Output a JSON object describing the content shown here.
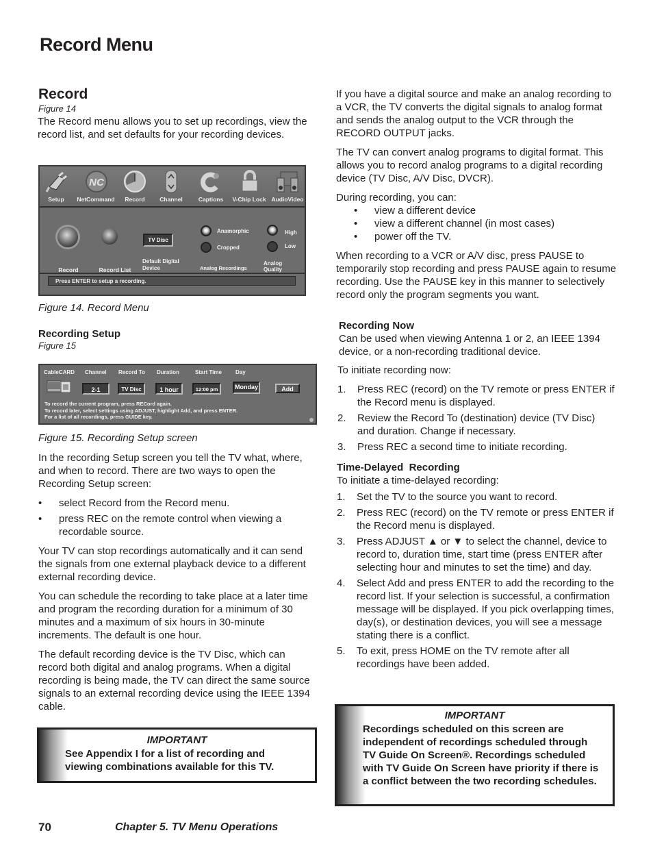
{
  "page": {
    "title": "Record Menu",
    "page_number": "70",
    "chapter": "Chapter 5. TV Menu Operations"
  },
  "left": {
    "record": {
      "heading": "Record",
      "figure_ref": "Figure 14",
      "intro": "The Record menu allows you to set up recordings, view the record list, and set defaults for your recording devices."
    },
    "figure14": {
      "caption": "Figure 14. Record Menu",
      "menu_items": [
        {
          "label": "Setup",
          "icon": "plug-icon"
        },
        {
          "label": "NetCommand",
          "icon": "netcommand-icon"
        },
        {
          "label": "Record",
          "icon": "clock-icon"
        },
        {
          "label": "Channel",
          "icon": "up-down-arrows-icon"
        },
        {
          "label": "Captions",
          "icon": "captions-icon"
        },
        {
          "label": "V-Chip Lock",
          "icon": "padlock-icon"
        },
        {
          "label": "AudioVideo",
          "icon": "speakers-icon"
        }
      ],
      "record_label": "Record",
      "record_list_label": "Record List",
      "default_device_value": "TV Disc",
      "default_device_label": "Default Digital Device",
      "analog_recordings": {
        "label": "Analog Recordings",
        "options": [
          {
            "label": "Anamorphic",
            "selected": true
          },
          {
            "label": "Cropped",
            "selected": false
          }
        ]
      },
      "analog_quality": {
        "label": "Analog Quality",
        "options": [
          {
            "label": "High",
            "selected": true
          },
          {
            "label": "Low",
            "selected": false
          }
        ]
      },
      "status": "Press ENTER to setup a recording."
    },
    "recording_setup": {
      "heading": "Recording Setup",
      "figure_ref": "Figure 15"
    },
    "figure15": {
      "caption": "Figure 15. Recording Setup screen",
      "columns": {
        "cablecard": "CableCARD",
        "channel": "Channel",
        "record_to": "Record To",
        "duration": "Duration",
        "start_time": "Start Time",
        "day": "Day"
      },
      "values": {
        "channel": "2-1",
        "record_to": "TV Disc",
        "duration": "1 hour",
        "start_time": "12:00 pm",
        "day": "Monday"
      },
      "add_button": "Add",
      "instructions": [
        "To record the current program, press RECord again.",
        "To record later, select settings using ADJUST, highlight Add, and press ENTER.",
        "For a list of all recordings, press GUIDE key."
      ]
    },
    "setup_intro": "In the recording Setup screen you tell the TV what, where, and when to record.  There are two ways to open the Recording Setup screen:",
    "setup_bullets": [
      "select Record from the Record menu.",
      "press REC on the remote control when viewing a recordable source."
    ],
    "paragraphs": [
      "Your TV can stop recordings automatically and it can send the signals from one external playback device to a different external recording device.",
      "You can schedule the recording to take place at a later time and program the recording duration for a minimum of 30 minutes and a maximum of six hours in 30-minute increments.  The default is one hour.",
      "The default recording device is the TV Disc, which can record both digital and analog programs.  When a digital recording is being made, the TV can direct the same source signals to an external recording device using the IEEE 1394 cable."
    ],
    "important": {
      "title": "IMPORTANT",
      "body": "See Appendix I for a list of recording and viewing combinations available for this TV."
    }
  },
  "right": {
    "paragraphs": [
      "If you have a digital source and make an analog recording to a VCR, the TV converts the digital signals to analog format and sends the analog output to the VCR through the RECORD OUTPUT jacks.",
      "The TV can convert analog programs to digital format. This allows you to record analog programs to a digital recording device (TV Disc, A/V Disc, DVCR)."
    ],
    "during_intro": "During recording, you can:",
    "during_bullets": [
      "view a different device",
      "view a different channel (in most cases)",
      "power off the TV."
    ],
    "pause_paragraph": "When recording to a VCR or A/V disc, press PAUSE to temporarily stop recording and press PAUSE again to resume recording.  Use the PAUSE key in this manner to selectively record only the program segments you want.",
    "recording_now": {
      "heading": "Recording Now",
      "desc": "Can be used when viewing Antenna 1 or 2, an IEEE 1394 device, or a non-recording traditional device.",
      "intro": "To initiate recording now:",
      "steps": [
        "Press REC (record) on the TV remote or press ENTER if the Record menu is displayed.",
        "Review the Record To (destination) device (TV Disc) and duration.  Change if necessary.",
        "Press REC a second time to initiate recording."
      ]
    },
    "time_delayed": {
      "heading": "Time-Delayed  Recording",
      "intro": "To initiate a time-delayed recording:",
      "steps": [
        "Set the TV to the source you want to record.",
        "Press REC (record) on the TV remote or press ENTER if the Record menu is displayed.",
        "Press ADJUST ▲ or ▼ to select the channel, device to record to, duration time, start time (press ENTER after selecting hour and minutes to set the time) and day.",
        "Select Add and press ENTER to add the recording to the record list.  If your selection is successful, a confirmation message will be displayed.  If you pick overlapping times, day(s), or destination devices, you will see a message stating there is a conflict.",
        "To exit, press HOME on the TV remote after all recordings have been added."
      ]
    },
    "important": {
      "title": "IMPORTANT",
      "body": "Recordings scheduled on this screen are independent of recordings scheduled through TV Guide On Screen®.  Recordings scheduled with TV Guide On Screen have priority if there is a conflict between the two recording schedules."
    }
  }
}
